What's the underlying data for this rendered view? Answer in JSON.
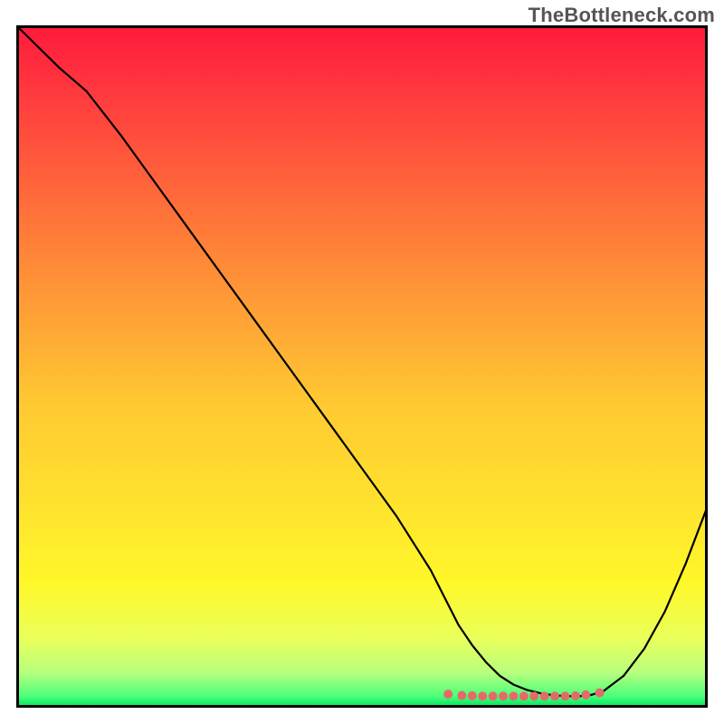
{
  "watermark": "TheBottleneck.com",
  "chart_data": {
    "type": "line",
    "title": "",
    "xlabel": "",
    "ylabel": "",
    "xlim": [
      0,
      100
    ],
    "ylim": [
      0,
      100
    ],
    "grid": false,
    "legend": false,
    "series": [
      {
        "name": "curve",
        "x": [
          0,
          6,
          10,
          15,
          20,
          25,
          30,
          35,
          40,
          45,
          50,
          55,
          60,
          62,
          63,
          64,
          66,
          68,
          70,
          72,
          74,
          76,
          78,
          80,
          81.5,
          83,
          85,
          88,
          91,
          94,
          97,
          100
        ],
        "y": [
          100,
          94,
          90.5,
          84,
          77,
          70,
          63,
          56,
          49,
          42,
          35,
          28,
          20,
          16,
          14,
          12,
          9,
          6.5,
          4.5,
          3.2,
          2.4,
          1.9,
          1.6,
          1.5,
          1.5,
          1.6,
          2.2,
          4.5,
          8.5,
          14,
          21,
          29
        ],
        "style": "black-thin"
      }
    ],
    "markers": {
      "name": "highlight-dots",
      "color": "#e46a6a",
      "x": [
        62.5,
        64.5,
        66,
        67.5,
        69,
        70.5,
        72,
        73.5,
        75,
        76.5,
        78,
        79.5,
        81,
        82.5,
        84.5
      ],
      "y": [
        1.8,
        1.6,
        1.55,
        1.5,
        1.5,
        1.5,
        1.5,
        1.5,
        1.5,
        1.5,
        1.5,
        1.5,
        1.55,
        1.7,
        2.0
      ]
    },
    "background_gradient": {
      "stops": [
        {
          "offset": 0.0,
          "color": "#ff1a3c"
        },
        {
          "offset": 0.1,
          "color": "#ff3a3e"
        },
        {
          "offset": 0.25,
          "color": "#ff6a3a"
        },
        {
          "offset": 0.4,
          "color": "#ff9a36"
        },
        {
          "offset": 0.55,
          "color": "#ffc832"
        },
        {
          "offset": 0.7,
          "color": "#ffe22e"
        },
        {
          "offset": 0.82,
          "color": "#fff82a"
        },
        {
          "offset": 0.9,
          "color": "#eaff5a"
        },
        {
          "offset": 0.95,
          "color": "#b8ff7e"
        },
        {
          "offset": 0.985,
          "color": "#4dff7a"
        },
        {
          "offset": 1.0,
          "color": "#00e660"
        }
      ]
    }
  }
}
